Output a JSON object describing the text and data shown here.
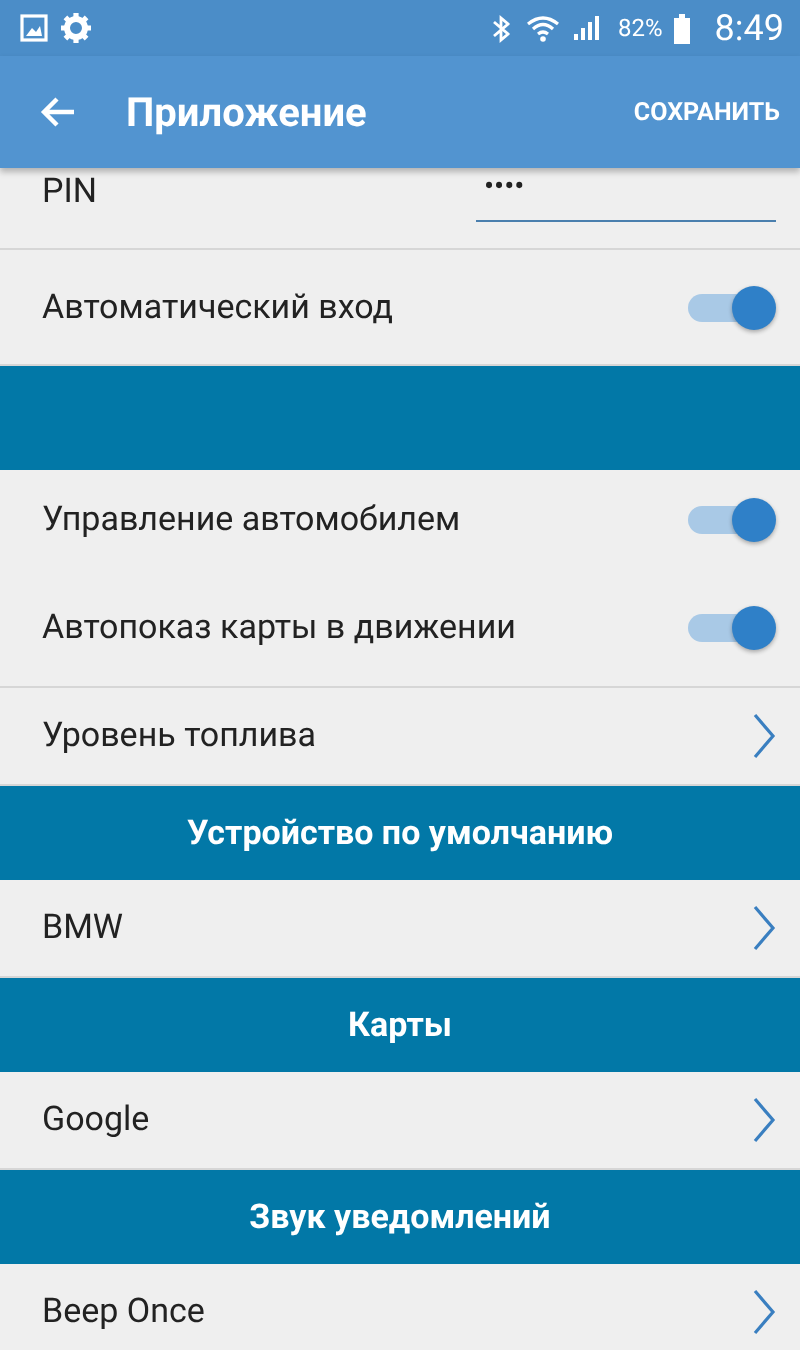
{
  "status_bar": {
    "battery": "82%",
    "time": "8:49"
  },
  "app_bar": {
    "title": "Приложение",
    "action": "СОХРАНИТЬ"
  },
  "items": [
    {
      "kind": "field",
      "label": "PIN",
      "value": "••••"
    },
    {
      "kind": "toggle",
      "label": "Автоматический вход",
      "on": true
    },
    {
      "kind": "header"
    },
    {
      "kind": "toggle",
      "label": "Управление автомобилем",
      "on": true
    },
    {
      "kind": "toggle",
      "label": "Автопоказ карты в движении",
      "on": true
    },
    {
      "kind": "link",
      "label": "Уровень топлива"
    },
    {
      "kind": "header",
      "title": "Устройство по умолчанию"
    },
    {
      "kind": "link",
      "label": "BMW"
    },
    {
      "kind": "header",
      "title": "Карты"
    },
    {
      "kind": "link",
      "label": "Google"
    },
    {
      "kind": "header",
      "title": "Звук уведомлений"
    },
    {
      "kind": "link",
      "label": "Beep Once"
    }
  ]
}
